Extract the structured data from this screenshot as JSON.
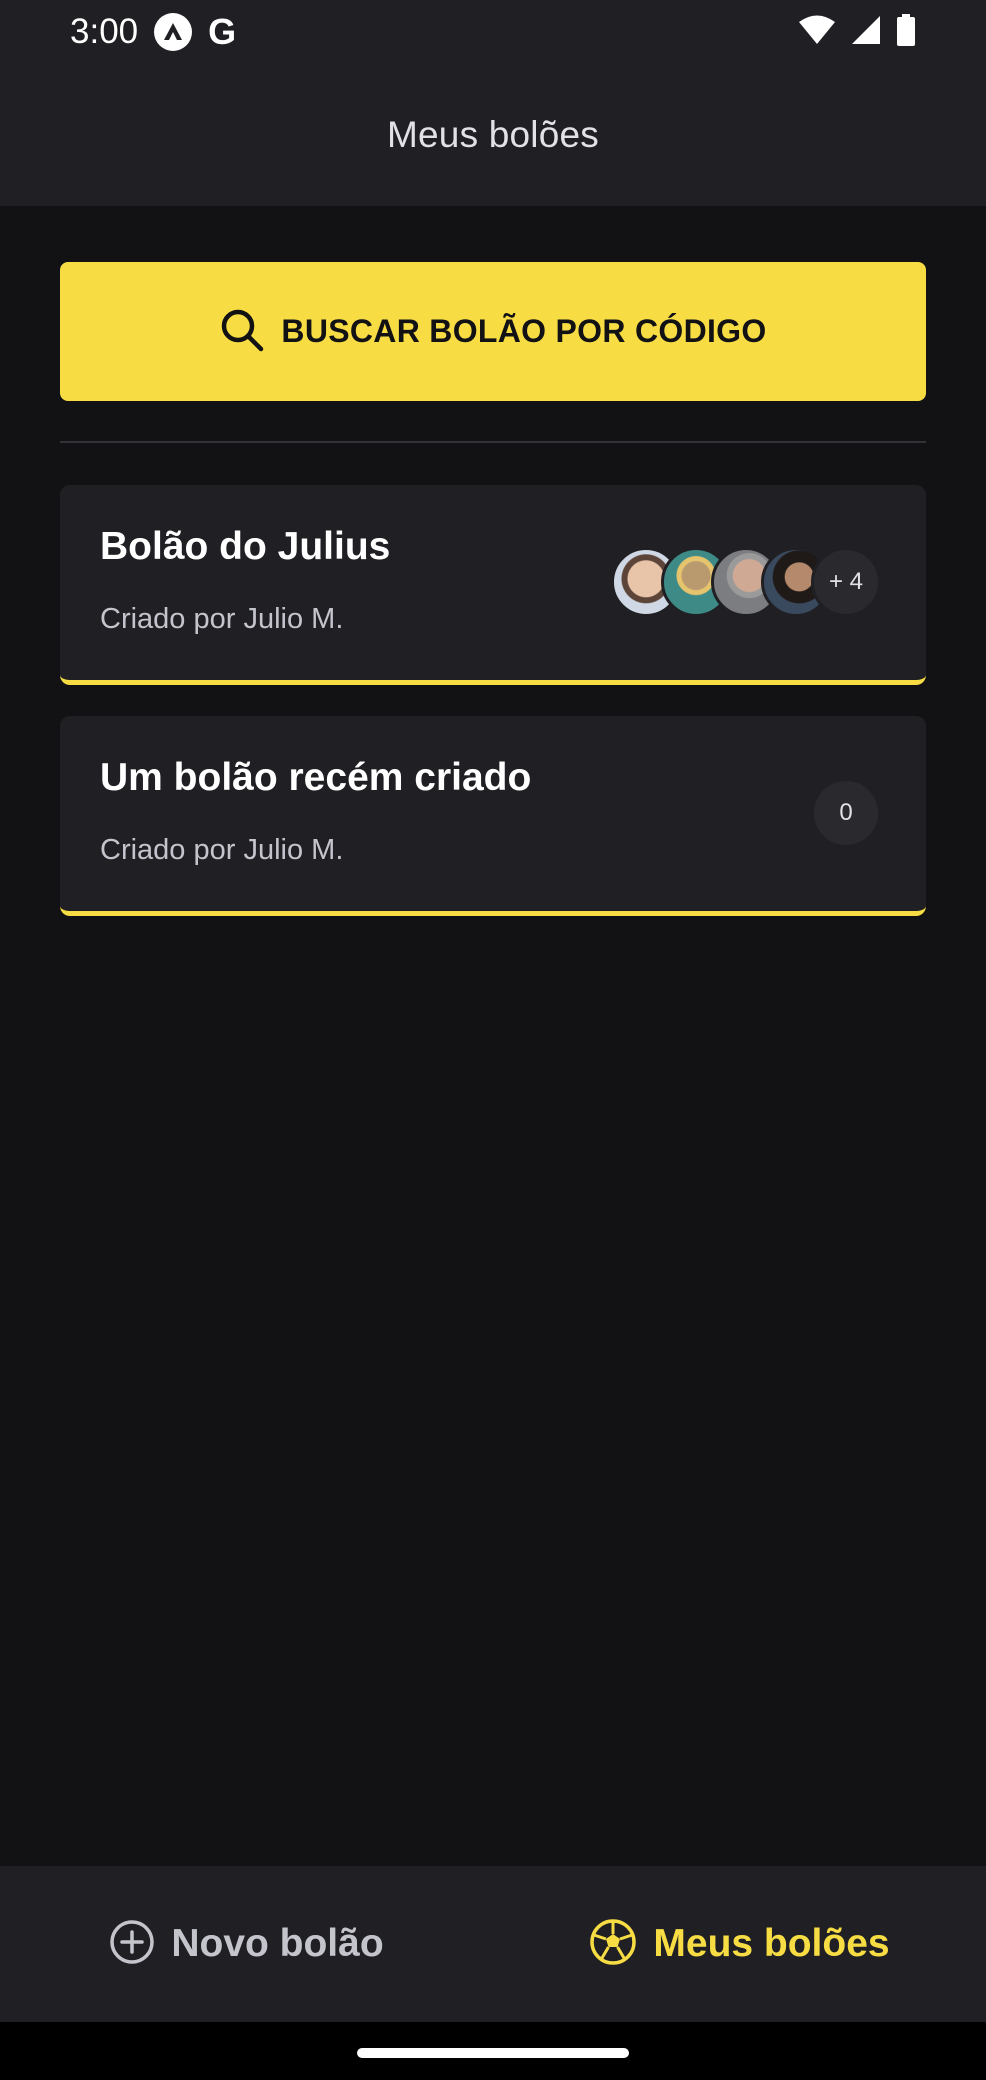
{
  "status_bar": {
    "time": "3:00",
    "google_glyph": "G",
    "icons": [
      "app-notification-icon",
      "google-icon",
      "wifi-icon",
      "signal-icon",
      "battery-icon"
    ]
  },
  "header": {
    "title": "Meus bolões"
  },
  "search": {
    "label": "BUSCAR BOLÃO POR CÓDIGO",
    "icon": "search-icon"
  },
  "pools": [
    {
      "title": "Bolão do Julius",
      "owner": "Criado por Julio M.",
      "participants_extra": "+ 4"
    },
    {
      "title": "Um bolão recém criado",
      "owner": "Criado por Julio M.",
      "participants_extra": "0"
    }
  ],
  "nav": {
    "items": [
      {
        "label": "Novo bolão",
        "icon": "plus-circle-icon",
        "active": false
      },
      {
        "label": "Meus bolões",
        "icon": "soccer-ball-icon",
        "active": true
      }
    ]
  },
  "colors": {
    "background": "#121214",
    "surface": "#202024",
    "accent": "#f7dd43",
    "text": "#e1e1e6",
    "muted": "#c4c4cc"
  }
}
